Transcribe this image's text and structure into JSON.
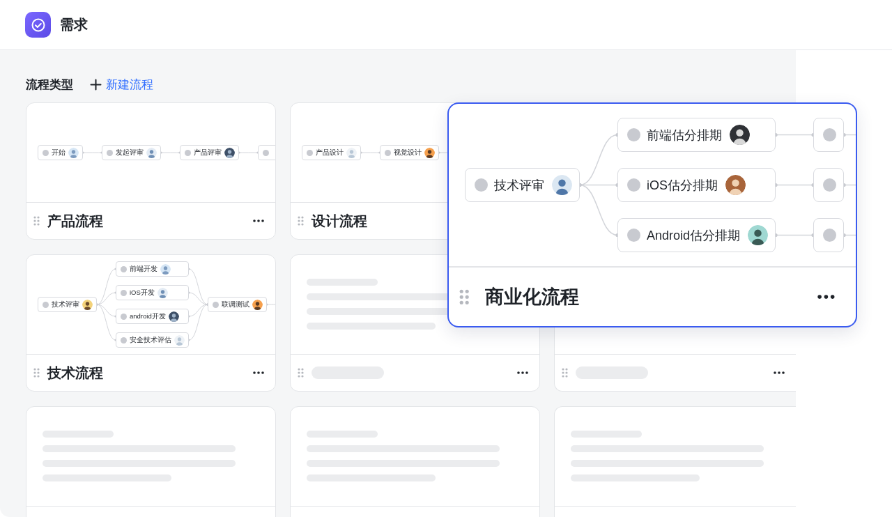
{
  "header": {
    "title": "需求"
  },
  "section": {
    "title": "流程类型",
    "new_button": "新建流程"
  },
  "cards": [
    {
      "kind": "flow",
      "title": "产品流程",
      "raised": false,
      "columns": [
        [
          {
            "label": "开始",
            "avatar": true
          }
        ],
        [
          {
            "label": "发起评审",
            "avatar": true
          }
        ],
        [
          {
            "label": "产品评审",
            "avatar": true
          }
        ],
        [
          {
            "avatar": false
          }
        ]
      ]
    },
    {
      "kind": "flow",
      "title": "设计流程",
      "raised": false,
      "columns": [
        [
          {
            "label": "产品设计",
            "avatar": true
          }
        ],
        [
          {
            "label": "视觉设计",
            "avatar": true
          }
        ]
      ]
    },
    {
      "kind": "flow",
      "title": "商业化流程",
      "raised": true,
      "columns": [
        [
          {
            "label": "技术评审",
            "avatar": true
          }
        ],
        [
          {
            "label": "前端估分排期",
            "avatar": true
          },
          {
            "label": "iOS估分排期",
            "avatar": true
          },
          {
            "label": "Android估分排期",
            "avatar": true
          }
        ],
        [
          {
            "avatar": false
          },
          {
            "avatar": false
          },
          {
            "avatar": false
          }
        ]
      ]
    },
    {
      "kind": "flow",
      "title": "技术流程",
      "raised": false,
      "columns": [
        [
          {
            "label": "技术评审",
            "avatar": true
          }
        ],
        [
          {
            "label": "前端开发",
            "avatar": true
          },
          {
            "label": "iOS开发",
            "avatar": true
          },
          {
            "label": "android开发",
            "avatar": true
          },
          {
            "label": "安全技术评估",
            "avatar": true
          }
        ],
        [
          {
            "label": "联调测试",
            "avatar": true
          }
        ]
      ]
    },
    {
      "kind": "skeleton"
    },
    {
      "kind": "skeleton"
    },
    {
      "kind": "skeleton"
    },
    {
      "kind": "skeleton"
    },
    {
      "kind": "skeleton"
    }
  ]
}
